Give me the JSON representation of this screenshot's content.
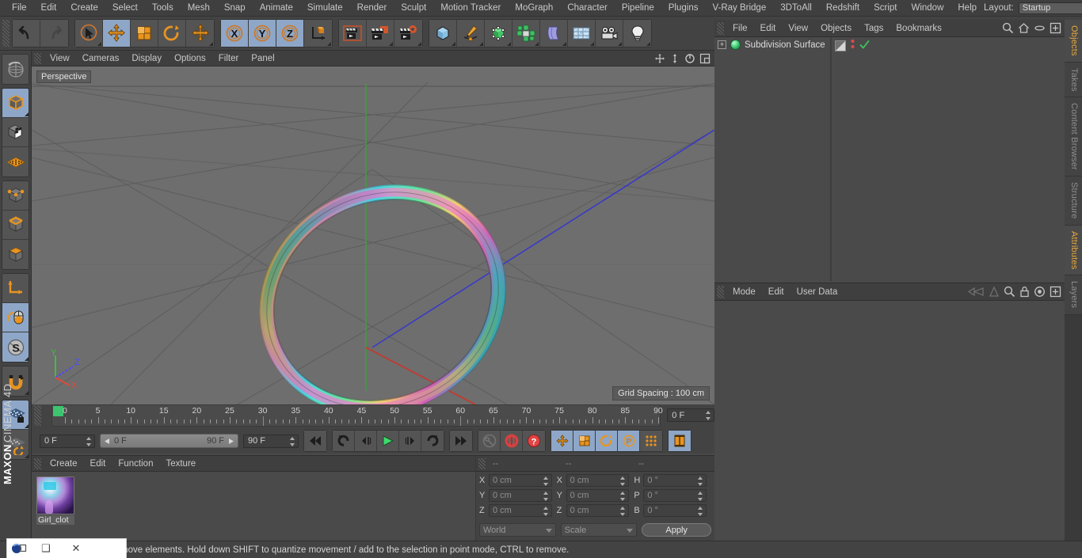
{
  "menubar": {
    "items": [
      "File",
      "Edit",
      "Create",
      "Select",
      "Tools",
      "Mesh",
      "Snap",
      "Animate",
      "Simulate",
      "Render",
      "Sculpt",
      "Motion Tracker",
      "MoGraph",
      "Character",
      "Pipeline",
      "Plugins",
      "V-Ray Bridge",
      "3DToAll",
      "Redshift",
      "Script",
      "Window",
      "Help"
    ],
    "layout_label": "Layout:",
    "layout_value": "Startup",
    "search_icon": "search-icon"
  },
  "toolbar": {
    "groups": [
      {
        "name": "undo-redo",
        "buttons": [
          {
            "name": "undo-button",
            "icon": "undo-arrow-icon",
            "active": false
          },
          {
            "name": "redo-button",
            "icon": "redo-arrow-icon",
            "active": false
          }
        ]
      },
      {
        "name": "transform-tools",
        "buttons": [
          {
            "name": "select-tool",
            "icon": "cursor-select-icon",
            "active": false
          },
          {
            "name": "move-tool",
            "icon": "move-arrows-icon",
            "active": true
          },
          {
            "name": "scale-tool",
            "icon": "scale-box-icon",
            "active": false
          },
          {
            "name": "rotate-tool",
            "icon": "rotate-circle-icon",
            "active": false
          },
          {
            "name": "move-duplicate-tool",
            "icon": "move-arrows-icon",
            "active": false
          }
        ]
      },
      {
        "name": "axis-locks",
        "buttons": [
          {
            "name": "lock-x-axis",
            "icon": "x-axis-icon",
            "active": true
          },
          {
            "name": "lock-y-axis",
            "icon": "y-axis-icon",
            "active": true
          },
          {
            "name": "lock-z-axis",
            "icon": "z-axis-icon",
            "active": true
          },
          {
            "name": "world-object-axis",
            "icon": "axis-cube-icon",
            "active": false
          }
        ]
      },
      {
        "name": "render-tools",
        "buttons": [
          {
            "name": "render-view-button",
            "icon": "render-view-icon",
            "active": false
          },
          {
            "name": "render-region-button",
            "icon": "render-region-icon",
            "active": false
          },
          {
            "name": "render-settings-button",
            "icon": "render-settings-gear-icon",
            "active": false
          }
        ]
      },
      {
        "name": "create-objects",
        "buttons": [
          {
            "name": "add-primitive-button",
            "icon": "cube-icon",
            "active": false
          },
          {
            "name": "add-spline-button",
            "icon": "pen-spline-icon",
            "active": false
          },
          {
            "name": "add-generator-button",
            "icon": "green-cube-nurbs-icon",
            "active": false
          },
          {
            "name": "add-array-button",
            "icon": "green-cluster-icon",
            "active": false
          },
          {
            "name": "add-deformer-button",
            "icon": "bend-deformer-icon",
            "active": false
          },
          {
            "name": "add-environment-button",
            "icon": "floor-grid-icon",
            "active": false
          },
          {
            "name": "add-camera-button",
            "icon": "camera-icon",
            "active": false
          },
          {
            "name": "add-light-button",
            "icon": "light-bulb-icon",
            "active": false
          }
        ]
      }
    ]
  },
  "left_toolbar": {
    "buttons": [
      {
        "name": "undo-view-tool",
        "icon": "globe-wire-icon",
        "active": false
      },
      {
        "name": "model-mode",
        "icon": "model-cube-icon",
        "active": true
      },
      {
        "name": "texture-mode",
        "icon": "texture-checker-cube-icon",
        "active": false
      },
      {
        "name": "workplane-mode",
        "icon": "workplane-grid-icon",
        "active": false
      },
      {
        "name": "points-mode",
        "icon": "points-cube-icon",
        "active": false
      },
      {
        "name": "edges-mode",
        "icon": "edges-cube-icon",
        "active": false
      },
      {
        "name": "polygons-mode",
        "icon": "polygons-cube-icon",
        "active": false
      },
      {
        "name": "axis-mode",
        "icon": "axis-arrows-icon",
        "active": false
      },
      {
        "name": "viewport-solo-tool",
        "icon": "mouse-icon",
        "active": true
      },
      {
        "name": "snap-mode",
        "icon": "snap-s-icon",
        "active": true
      },
      {
        "name": "magnet-tool",
        "icon": "magnet-icon",
        "active": false
      },
      {
        "name": "lock-workplane",
        "icon": "workplane-lock-icon",
        "active": true
      },
      {
        "name": "workplane-rotate",
        "icon": "workplane-rotate-icon",
        "active": false
      }
    ],
    "brand_primary": "MAXON",
    "brand_secondary": "CINEMA 4D"
  },
  "viewport": {
    "menu": [
      "View",
      "Cameras",
      "Display",
      "Options",
      "Filter",
      "Panel"
    ],
    "nav_icons": [
      "pan-icon",
      "dolly-icon",
      "rotate-icon",
      "maximize-icon"
    ],
    "label": "Perspective",
    "grid_spacing": "Grid Spacing : 100 cm",
    "axis_gizmo": {
      "x": "X",
      "y": "Y",
      "z": "Z"
    },
    "colors": {
      "background": "#6e6e6e",
      "grid_line": "#5d5d5d",
      "axis_x": "#c0392b",
      "axis_y": "#3a9a3a",
      "axis_z": "#3a3ac0"
    },
    "object": {
      "name": "rainbow-torus-ring",
      "description": "Subdivision Surface torus with rainbow gradient material"
    }
  },
  "timeline": {
    "ticks": [
      0,
      5,
      10,
      15,
      20,
      25,
      30,
      35,
      40,
      45,
      50,
      55,
      60,
      65,
      70,
      75,
      80,
      85,
      90
    ],
    "current_frame_field": "0 F",
    "start_frame_field": "0 F",
    "range_start": "0 F",
    "range_end": "90 F",
    "end_frame_field": "90 F",
    "playback_buttons": [
      {
        "name": "go-to-start-button",
        "icon": "skip-start-icon",
        "active": false
      },
      {
        "name": "previous-keyframe-button",
        "icon": "prev-key-icon",
        "active": false
      },
      {
        "name": "step-back-button",
        "icon": "step-back-icon",
        "active": false
      },
      {
        "name": "play-button",
        "icon": "play-icon",
        "active": false
      },
      {
        "name": "step-forward-button",
        "icon": "step-forward-icon",
        "active": false
      },
      {
        "name": "next-keyframe-button",
        "icon": "next-key-icon",
        "active": false
      },
      {
        "name": "go-to-end-button",
        "icon": "skip-end-icon",
        "active": false
      }
    ],
    "record_buttons": [
      {
        "name": "record-active-objects-button",
        "icon": "key-record-icon",
        "active": false
      },
      {
        "name": "autokeying-button",
        "icon": "red-circle-icon",
        "active": false
      },
      {
        "name": "keyframe-selection-button",
        "icon": "red-question-icon",
        "active": false
      }
    ],
    "key_filter_buttons": [
      {
        "name": "position-key-button",
        "icon": "move-arrows-icon",
        "active": true
      },
      {
        "name": "scale-key-button",
        "icon": "scale-box-icon",
        "active": true
      },
      {
        "name": "rotation-key-button",
        "icon": "rotate-circle-icon",
        "active": true
      },
      {
        "name": "parameter-key-button",
        "icon": "p-circle-icon",
        "active": true
      },
      {
        "name": "point-level-animation-button",
        "icon": "dot-matrix-icon",
        "active": false
      },
      {
        "name": "timeline-toggle-button",
        "icon": "film-strip-icon",
        "active": true
      }
    ]
  },
  "material_manager": {
    "menu": [
      "Create",
      "Edit",
      "Function",
      "Texture"
    ],
    "materials": [
      {
        "name": "Girl_clot",
        "selected": true
      }
    ]
  },
  "coordinates": {
    "headers": [
      "--",
      "--",
      "--"
    ],
    "rows": [
      {
        "label1": "X",
        "value1": "0 cm",
        "label2": "X",
        "value2": "0 cm",
        "label3": "H",
        "value3": "0 °"
      },
      {
        "label1": "Y",
        "value1": "0 cm",
        "label2": "Y",
        "value2": "0 cm",
        "label3": "P",
        "value3": "0 °"
      },
      {
        "label1": "Z",
        "value1": "0 cm",
        "label2": "Z",
        "value2": "0 cm",
        "label3": "B",
        "value3": "0 °"
      }
    ],
    "system_select": "World",
    "mode_select": "Scale",
    "apply_label": "Apply"
  },
  "object_manager": {
    "menu": [
      "File",
      "Edit",
      "View",
      "Objects",
      "Tags",
      "Bookmarks"
    ],
    "header_icons": [
      "search-icon",
      "home-icon",
      "ellipse-icon",
      "add-layer-icon"
    ],
    "objects": [
      {
        "name": "Subdivision Surface",
        "expandable": "+",
        "icon": "subdivision-surface-icon",
        "tags": [
          "material-tag",
          "visibility-dots",
          "check-mark"
        ]
      }
    ]
  },
  "attributes": {
    "menu": [
      "Mode",
      "Edit",
      "User Data"
    ],
    "header_icons": [
      "back-nav-icon",
      "forward-nav-icon",
      "search-icon",
      "lock-icon",
      "target-icon",
      "add-icon"
    ],
    "content": ""
  },
  "vertical_tabs": [
    {
      "label": "Objects",
      "active": true
    },
    {
      "label": "Takes",
      "active": false
    },
    {
      "label": "Content Browser",
      "active": false
    },
    {
      "label": "Structure",
      "active": false
    },
    {
      "label": "Attributes",
      "active": true
    },
    {
      "label": "Layers",
      "active": false
    }
  ],
  "statusbar": {
    "text": "move elements. Hold down SHIFT to quantize movement / add to the selection in point mode, CTRL to remove."
  },
  "window_controls": {
    "app_icon": "cinema4d-logo-icon",
    "restore_label": "❑",
    "minimize_label": "–",
    "close_label": "✕"
  }
}
